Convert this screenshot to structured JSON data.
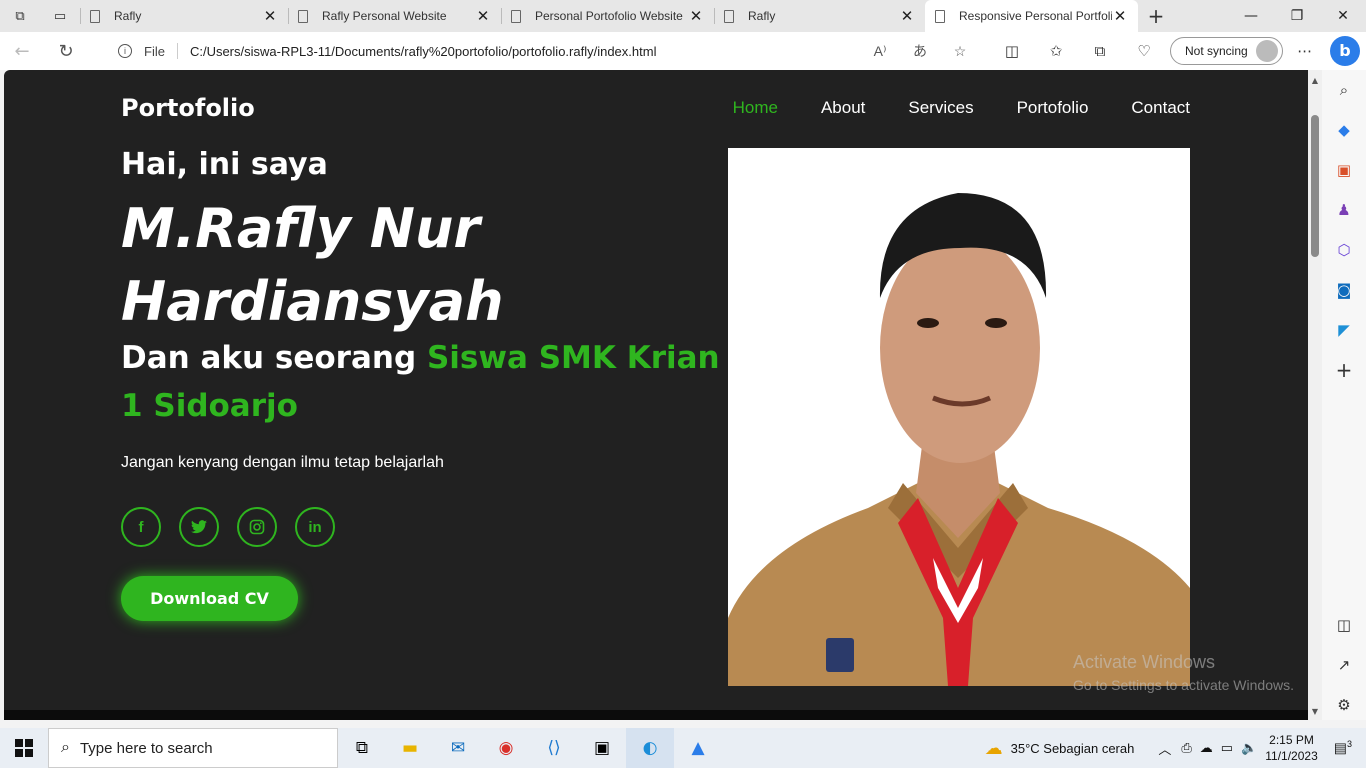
{
  "browser": {
    "tabs": [
      {
        "title": "Rafly"
      },
      {
        "title": "Rafly Personal Website"
      },
      {
        "title": "Personal Portofolio Website"
      },
      {
        "title": "Rafly"
      },
      {
        "title": "Responsive Personal Portfolio"
      }
    ],
    "file_label": "File",
    "url": "C:/Users/siswa-RPL3-11/Documents/rafly%20portofolio/portofolio.rafly/index.html",
    "sync_label": "Not syncing",
    "bing_label": "b"
  },
  "site": {
    "logo": "Portofolio",
    "nav": [
      "Home",
      "About",
      "Services",
      "Portofolio",
      "Contact"
    ],
    "greeting": "Hai, ini saya",
    "name": "M.Rafly Nur Hardiansyah",
    "role_prefix": "Dan aku seorang ",
    "role_highlight": "Siswa SMK Krian 1 Sidoarjo",
    "motto": "Jangan kenyang dengan ilmu tetap belajarlah",
    "social": [
      "f",
      "t",
      "ig",
      "in"
    ],
    "cv_button": "Download CV",
    "accent": "#2fb51f"
  },
  "watermark": {
    "line1": "Activate Windows",
    "line2": "Go to Settings to activate Windows."
  },
  "taskbar": {
    "search_placeholder": "Type here to search",
    "weather": "35°C  Sebagian cerah",
    "time": "2:15 PM",
    "date": "11/1/2023",
    "notifications": "3"
  }
}
